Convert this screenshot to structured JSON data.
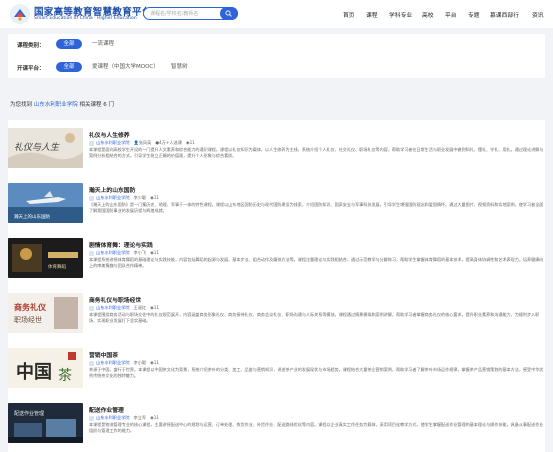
{
  "header": {
    "logo_cn": "国家高等教育智慧教育平台",
    "logo_en": "Smart Education of China · Higher Education",
    "search_placeholder": "课程名/学校名/教师名",
    "nav": [
      "首页",
      "课程",
      "学科专业",
      "高校",
      "平台",
      "专题",
      "慕课西部行",
      "资讯"
    ]
  },
  "filters": {
    "category_label": "课程类别：",
    "category_options": [
      "全部",
      "一流课程"
    ],
    "platform_label": "开课平台：",
    "platform_options": [
      "全部",
      "爱课程（中国大学MOOC）",
      "智慧树"
    ]
  },
  "result": {
    "prefix": "为您找到",
    "keyword": "山东水利职业学院",
    "middle": "相关课程",
    "count": "6",
    "unit": "门"
  },
  "courses": [
    {
      "title": "礼仪与人生修养",
      "school": "山东水利职业学院",
      "teacher": "张凤英",
      "enroll": "4万+人选课",
      "views": "11",
      "desc": "本课程是面向高校学生开设的一门提升人文素养和综合能力的通识课程。课程以礼仪知识为载体，以人生修养为主线，系统介绍个人礼仪、社交礼仪、职场礼仪等内容，帮助学习者在日常生活与职业发展中做到知礼、懂礼、守礼、用礼。通过理论讲解与案例分析相结合的方式，引导学生树立正确的价值观，提升个人形象与综合素质。"
    },
    {
      "title": "瀚天上的山东国防",
      "school": "山东水利职业学院",
      "teacher": "李少聪",
      "enroll": "",
      "views": "11",
      "desc": "《瀚天上的山东国防》是一门集历史、地理、军事于一体的特色课程。课程以山东地区国防历史与现代国防建设为线索，介绍国防知识、国家安全与军事科技发展，引导学生增强国防观念和爱国情怀。通过大量图片、视频资料和实地案例，使学习者全面了解我国国防事业的发展历程与辉煌成就。"
    },
    {
      "title": "剧情体育舞：理论与实践",
      "school": "山东水利职业学院",
      "teacher": "李小飞",
      "enroll": "",
      "views": "11",
      "desc": "本课程系统讲授体育舞蹈的基础理论与实践技能，内容包括舞蹈的起源与发展、基本步法、组合动作及编排方法等。课程注重理论与实践相结合，通过示范教学与分解练习，帮助学生掌握体育舞蹈的基本技术，提高身体协调性和艺术表现力，培养健康向上的审美情趣与团队合作精神。"
    },
    {
      "title": "商务礼仪与职场经世",
      "school": "山东水利职业学院",
      "teacher": "王淑红",
      "enroll": "",
      "views": "11",
      "desc": "本课程围绕商务活动与职场交往中的礼仪规范展开，内容涵盖商务形象礼仪、商务接待礼仪、商务会议礼仪、职场沟通与人际关系等模块。课程通过情景模拟和案例讲解，帮助学习者掌握商务礼仪的核心要求，提升职业素养和沟通能力，为顺利步入职场、实现职业发展打下坚实基础。"
    },
    {
      "title": "营销中国茶",
      "school": "山东水利职业学院",
      "teacher": "李小聪",
      "enroll": "",
      "views": "11",
      "desc": "茶源于中国，盛行于世界。本课程以中国茶文化为背景，系统介绍茶叶的分类、加工、品鉴与营销知识，讲述茶产业的发展现状与市场趋势。课程结合大量茶企营销案例，帮助学习者了解茶叶市场运作规律，掌握茶产品营销策划的基本方法，感受中华优秀传统茶文化的独特魅力。"
    },
    {
      "title": "配送作业管理",
      "school": "山东水利职业学院",
      "teacher": "李立军",
      "enroll": "",
      "views": "11",
      "desc": "本课程是物流管理专业的核心课程，主要讲授配送中心的规划与运营、订单处理、拣货作业、补货作业、配送路线优化等内容。课程以企业真实工作任务为载体，采用项目化教学方式，使学生掌握配送作业管理的基本理论与操作技能，具备从事配送作业组织与管理工作的能力。"
    }
  ],
  "colors": {
    "accent": "#2f64d8",
    "bg": "#f2f3f6"
  }
}
